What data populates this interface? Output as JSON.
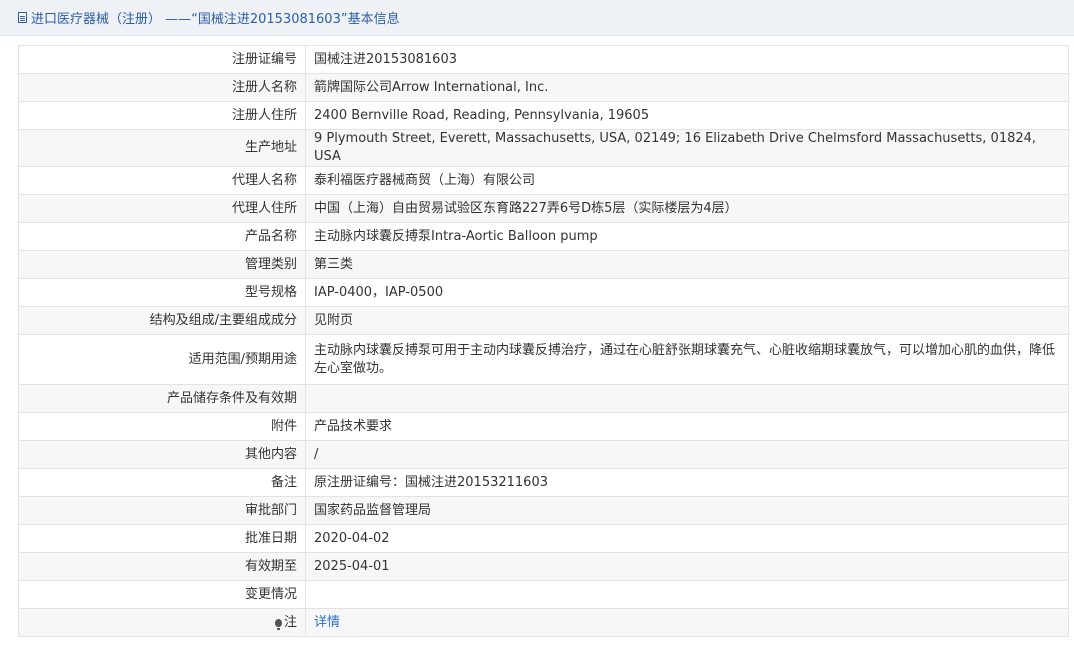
{
  "header": {
    "title": "进口医疗器械（注册） ——“国械注进20153081603”基本信息"
  },
  "rows": [
    {
      "label": "注册证编号",
      "value": "国械注进20153081603"
    },
    {
      "label": "注册人名称",
      "value": "箭牌国际公司Arrow International, Inc."
    },
    {
      "label": "注册人住所",
      "value": "2400 Bernville Road, Reading, Pennsylvania, 19605"
    },
    {
      "label": "生产地址",
      "value": "9 Plymouth Street, Everett, Massachusetts, USA, 02149; 16 Elizabeth Drive Chelmsford Massachusetts, 01824, USA"
    },
    {
      "label": "代理人名称",
      "value": "泰利福医疗器械商贸（上海）有限公司"
    },
    {
      "label": "代理人住所",
      "value": "中国（上海）自由贸易试验区东育路227弄6号D栋5层（实际楼层为4层）"
    },
    {
      "label": "产品名称",
      "value": "主动脉内球囊反搏泵Intra-Aortic Balloon pump"
    },
    {
      "label": "管理类别",
      "value": "第三类"
    },
    {
      "label": "型号规格",
      "value": "IAP-0400，IAP-0500"
    },
    {
      "label": "结构及组成/主要组成成分",
      "value": "见附页"
    },
    {
      "label": "适用范围/预期用途",
      "value": "主动脉内球囊反搏泵可用于主动内球囊反搏治疗，通过在心脏舒张期球囊充气、心脏收缩期球囊放气，可以增加心肌的血供，降低左心室做功。"
    },
    {
      "label": "产品储存条件及有效期",
      "value": ""
    },
    {
      "label": "附件",
      "value": "产品技术要求"
    },
    {
      "label": "其他内容",
      "value": "/"
    },
    {
      "label": "备注",
      "value": "原注册证编号：国械注进20153211603"
    },
    {
      "label": "审批部门",
      "value": "国家药品监督管理局"
    },
    {
      "label": "批准日期",
      "value": "2020-04-02"
    },
    {
      "label": "有效期至",
      "value": "2025-04-01"
    },
    {
      "label": "变更情况",
      "value": ""
    }
  ],
  "note": {
    "label": "注",
    "icon": "lightbulb-icon",
    "link_text": "详情"
  }
}
